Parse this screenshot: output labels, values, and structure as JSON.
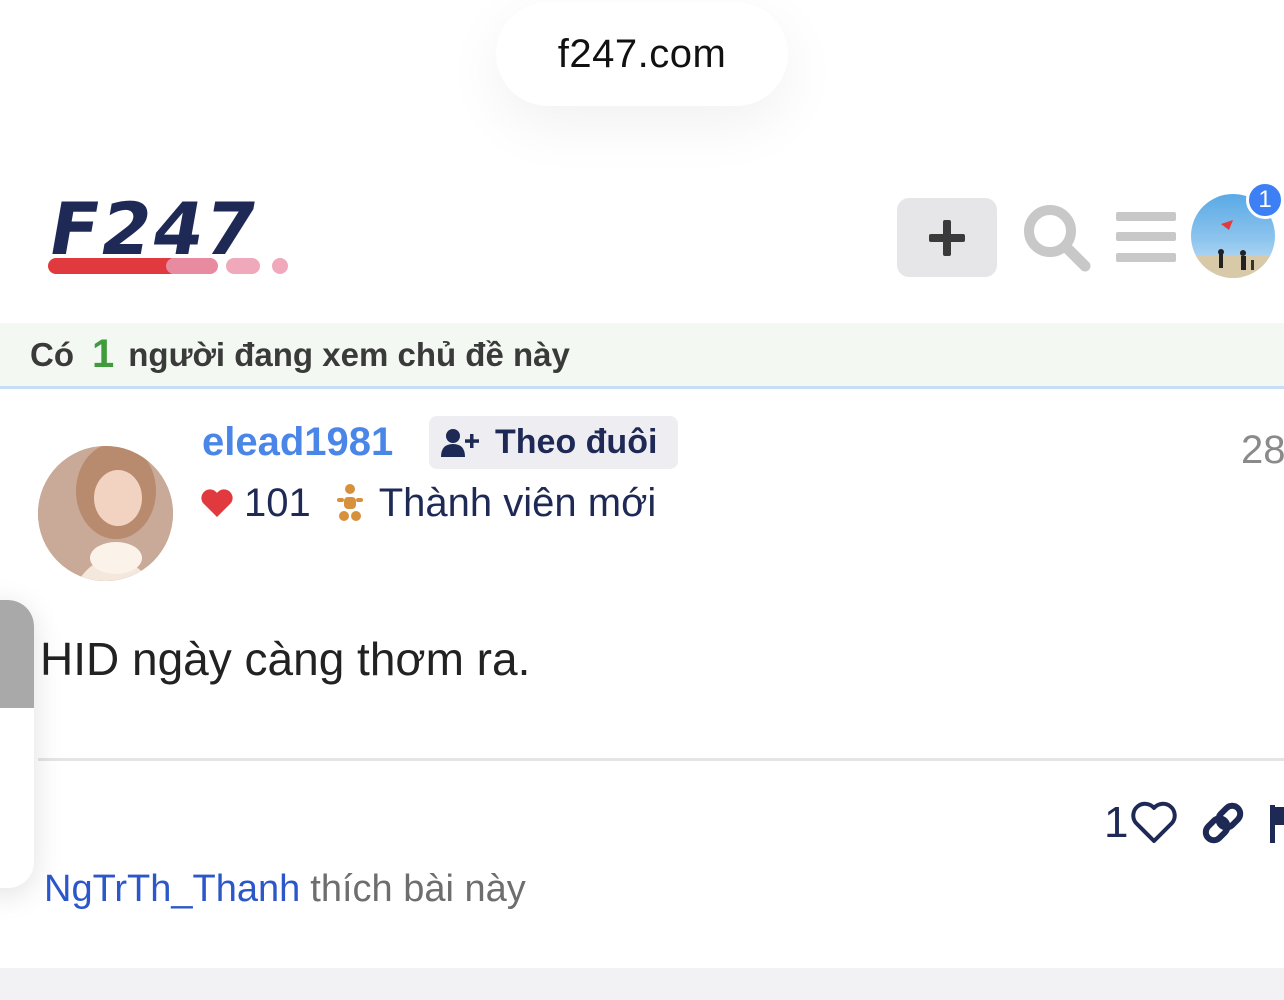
{
  "browser": {
    "url": "f247.com"
  },
  "header": {
    "logo_text": "F247",
    "notification_count": "1",
    "icons": [
      "plus-icon",
      "search-icon",
      "menu-icon",
      "avatar"
    ]
  },
  "topic": {
    "viewers_prefix": "Có",
    "viewers_count": "1",
    "viewers_suffix": "người đang xem chủ đề này"
  },
  "post": {
    "username": "elead1981",
    "follow_label": "Theo đuôi",
    "date": "28",
    "likes_received": "101",
    "rank": "Thành viên mới",
    "body": "HID ngày càng thơm ra.",
    "like_count": "1",
    "liked_by_user": "NgTrTh_Thanh",
    "liked_by_text": "thích bài này"
  },
  "colors": {
    "brand_navy": "#1e2a55",
    "brand_red": "#e0393e",
    "link_blue": "#4a86e8",
    "viewer_green": "#3f9b3b",
    "badge_blue": "#3d7ff5"
  }
}
